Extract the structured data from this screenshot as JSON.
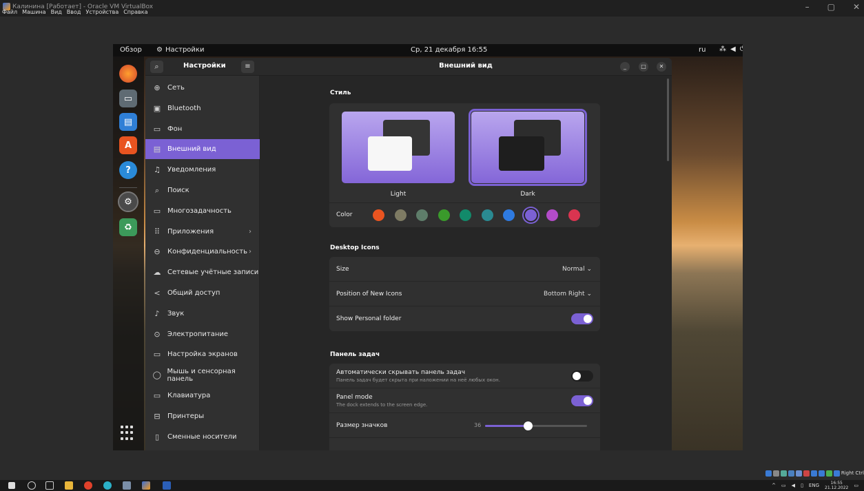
{
  "host": {
    "title": "Калинина [Работает] - Oracle VM VirtualBox",
    "menu": [
      "Файл",
      "Машина",
      "Вид",
      "Ввод",
      "Устройства",
      "Справка"
    ],
    "minimize_icon": "minimize-icon",
    "maximize_icon": "maximize-icon",
    "close_icon": "close-icon",
    "right_ctrl": "Right Ctrl"
  },
  "topbar": {
    "overview": "Обзор",
    "app_name": "Настройки",
    "clock": "Ср, 21 декабря  16:55",
    "lang": "ru"
  },
  "sidebar": {
    "title": "Настройки",
    "items": [
      {
        "label": "Сеть",
        "icon": "network-icon",
        "glyph": "⊕"
      },
      {
        "label": "Bluetooth",
        "icon": "bluetooth-icon",
        "glyph": "▣"
      },
      {
        "label": "Фон",
        "icon": "background-icon",
        "glyph": "▭"
      },
      {
        "label": "Внешний вид",
        "icon": "appearance-icon",
        "glyph": "▤",
        "active": true
      },
      {
        "label": "Уведомления",
        "icon": "bell-icon",
        "glyph": "♫"
      },
      {
        "label": "Поиск",
        "icon": "search-icon",
        "glyph": "⌕"
      },
      {
        "label": "Многозадачность",
        "icon": "multitasking-icon",
        "glyph": "▭"
      },
      {
        "label": "Приложения",
        "icon": "apps-icon",
        "glyph": "⠿",
        "chevron": true
      },
      {
        "label": "Конфиденциальность",
        "icon": "lock-icon",
        "glyph": "⊖",
        "chevron": true
      },
      {
        "label": "Сетевые учётные записи",
        "icon": "cloud-icon",
        "glyph": "☁"
      },
      {
        "label": "Общий доступ",
        "icon": "share-icon",
        "glyph": "<"
      },
      {
        "label": "Звук",
        "icon": "sound-icon",
        "glyph": "♪"
      },
      {
        "label": "Электропитание",
        "icon": "power-icon",
        "glyph": "⊙"
      },
      {
        "label": "Настройка экранов",
        "icon": "display-icon",
        "glyph": "▭"
      },
      {
        "label": "Мышь и сенсорная панель",
        "icon": "mouse-icon",
        "glyph": "◯"
      },
      {
        "label": "Клавиатура",
        "icon": "keyboard-icon",
        "glyph": "▭"
      },
      {
        "label": "Принтеры",
        "icon": "printer-icon",
        "glyph": "⊟"
      },
      {
        "label": "Сменные носители",
        "icon": "media-icon",
        "glyph": "▯"
      }
    ]
  },
  "content": {
    "title": "Внешний вид",
    "style_section": "Стиль",
    "light_label": "Light",
    "dark_label": "Dark",
    "color_label": "Color",
    "colors": [
      "#e95420",
      "#7e7b63",
      "#5e7d6a",
      "#3a9a2b",
      "#128a6a",
      "#2a8a92",
      "#2e7ae0",
      "#7b61d4",
      "#b34cc9",
      "#da3450"
    ],
    "selected_color": "#7b61d4",
    "desktop_icons_section": "Desktop Icons",
    "size_label": "Size",
    "size_value": "Normal",
    "position_label": "Position of New Icons",
    "position_value": "Bottom Right",
    "personal_label": "Show Personal folder",
    "personal_on": true,
    "panel_section": "Панель задач",
    "autohide_label": "Автоматически скрывать панель задач",
    "autohide_sub": "Панель задач будет скрыта при наложении на неё любых окон.",
    "autohide_on": false,
    "panel_mode_label": "Panel mode",
    "panel_mode_sub": "The dock extends to the screen edge.",
    "panel_mode_on": true,
    "icon_size_label": "Размер значков",
    "icon_size_value": "36"
  },
  "taskbar": {
    "lang": "ENG",
    "time": "16:55",
    "date": "21.12.2022"
  }
}
